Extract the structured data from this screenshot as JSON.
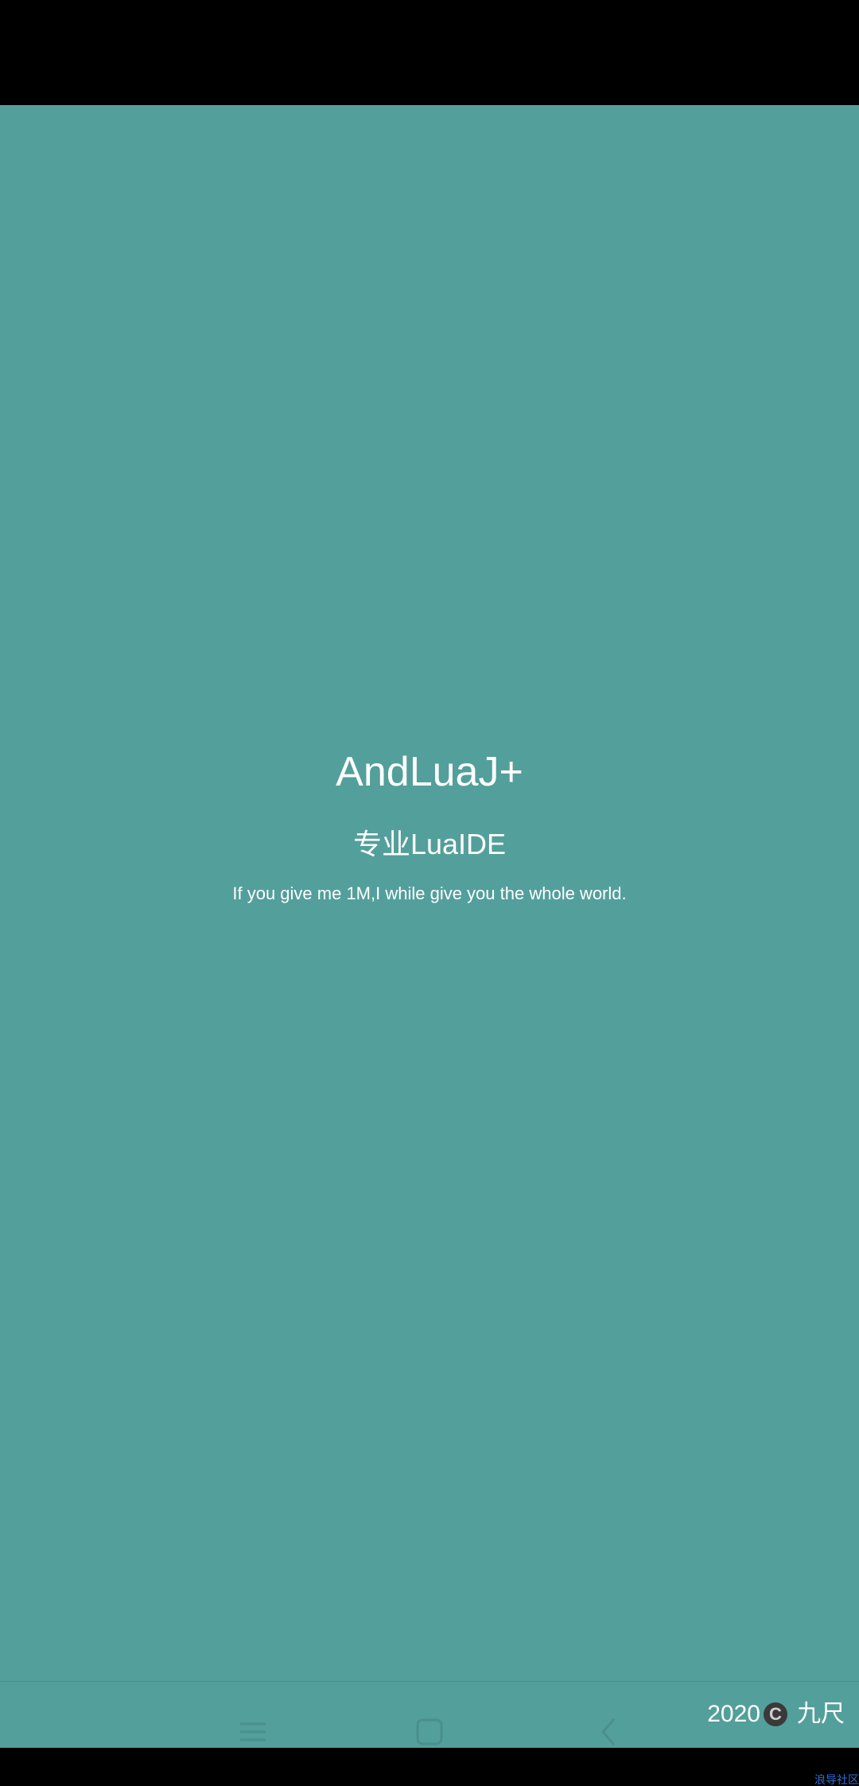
{
  "app": {
    "title": "AndLuaJ+",
    "subtitle": "专业LuaIDE",
    "tagline": "If you give me 1M,I while give you the whole world."
  },
  "footer": {
    "year": "2020",
    "copyright_symbol": "C",
    "author": "九尺"
  },
  "watermark": "浪导社区",
  "nav_icons": [
    "menu-icon",
    "home-square-icon",
    "back-chevron-icon"
  ],
  "colors": {
    "background": "#539F9B",
    "text": "#ffffff",
    "system_bars": "#000000"
  }
}
